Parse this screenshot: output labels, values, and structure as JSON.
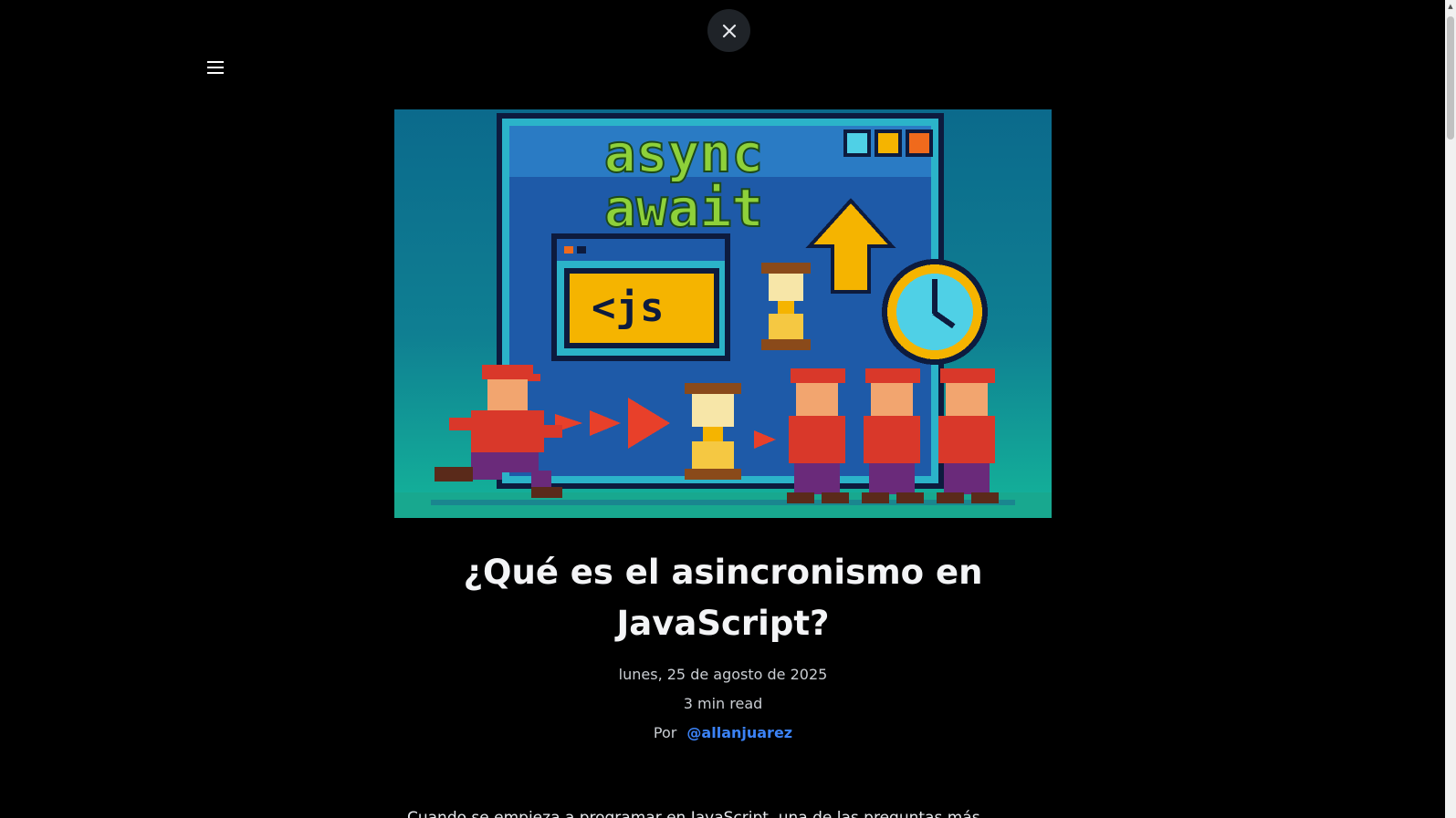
{
  "icons": {
    "close": "close-icon",
    "menu": "hamburger-menu-icon"
  },
  "hero": {
    "image_text_line1": "async",
    "image_text_line2": "await",
    "image_code_text": "<js"
  },
  "article": {
    "title": "¿Qué es el asincronismo en JavaScript?",
    "date": "lunes, 25 de agosto de 2025",
    "read_time": "3 min read",
    "author_prefix": "Por",
    "author_handle": "@allanjuarez",
    "body_preview": "Cuando se empieza a programar en JavaScript, una de las preguntas más"
  },
  "colors": {
    "background": "#000000",
    "link": "#3b82f6",
    "close_button_bg": "#1f2328"
  }
}
